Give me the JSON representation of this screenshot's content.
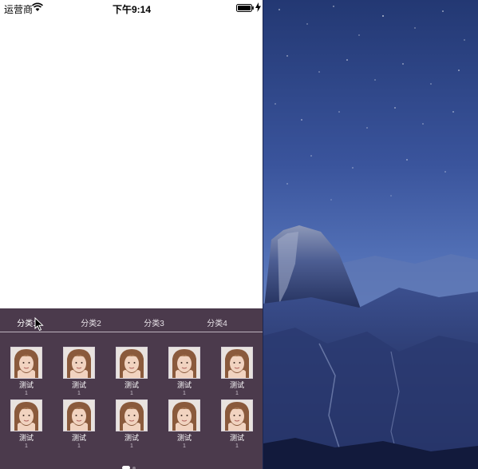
{
  "status_bar": {
    "carrier": "运营商",
    "time": "下午9:14",
    "icons": [
      "wifi-icon",
      "battery-icon",
      "charging-icon"
    ]
  },
  "panel": {
    "background": "#4b3a4c",
    "tabs": [
      {
        "label": "分类1",
        "active": true
      },
      {
        "label": "分类2",
        "active": false
      },
      {
        "label": "分类3",
        "active": false
      },
      {
        "label": "分类4",
        "active": false
      }
    ],
    "items": [
      {
        "label": "测试",
        "count": "1"
      },
      {
        "label": "测试",
        "count": "1"
      },
      {
        "label": "测试",
        "count": "1"
      },
      {
        "label": "测试",
        "count": "1"
      },
      {
        "label": "测试",
        "count": "1"
      },
      {
        "label": "测试",
        "count": "1"
      },
      {
        "label": "测试",
        "count": "1"
      },
      {
        "label": "测试",
        "count": "1"
      },
      {
        "label": "测试",
        "count": "1"
      },
      {
        "label": "测试",
        "count": "1"
      }
    ],
    "pager": {
      "pages": 2,
      "current": 1
    }
  },
  "desktop": {
    "wallpaper": "mountain-night-sky"
  }
}
